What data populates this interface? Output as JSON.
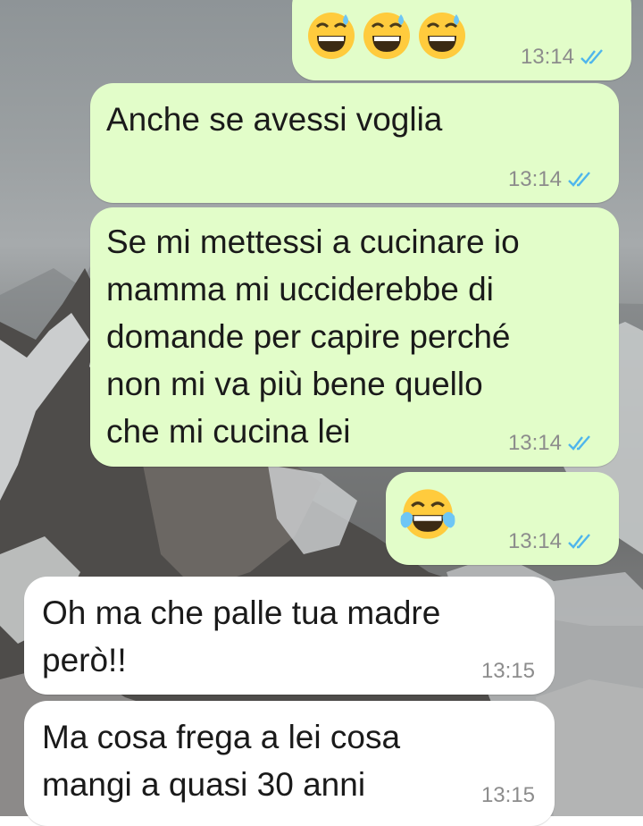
{
  "colors": {
    "outgoing_bubble": "#e2fdc9",
    "incoming_bubble": "#ffffff",
    "read_ticks": "#4fb6ec",
    "timestamp": "#8c8c8c",
    "text": "#1a1a1a"
  },
  "messages": [
    {
      "direction": "outgoing",
      "emojis": [
        "grinning-sweat-emoji",
        "grinning-sweat-emoji",
        "grinning-sweat-emoji"
      ],
      "text": "",
      "time": "13:14",
      "status": "read-double-check-icon"
    },
    {
      "direction": "outgoing",
      "text": "Anche se avessi voglia",
      "time": "13:14",
      "status": "read-double-check-icon"
    },
    {
      "direction": "outgoing",
      "text": "Se mi mettessi a cucinare io\nmamma mi ucciderebbe di\ndomande per capire perché\nnon mi va più bene quello\nche mi cucina lei",
      "time": "13:14",
      "status": "read-double-check-icon"
    },
    {
      "direction": "outgoing",
      "emojis": [
        "tears-of-joy-emoji"
      ],
      "text": "",
      "time": "13:14",
      "status": "read-double-check-icon"
    },
    {
      "direction": "incoming",
      "text": "Oh ma che palle tua madre\nperò!!",
      "time": "13:15"
    },
    {
      "direction": "incoming",
      "text": "Ma cosa frega a lei cosa\nmangi a quasi 30 anni",
      "time": "13:15"
    }
  ]
}
